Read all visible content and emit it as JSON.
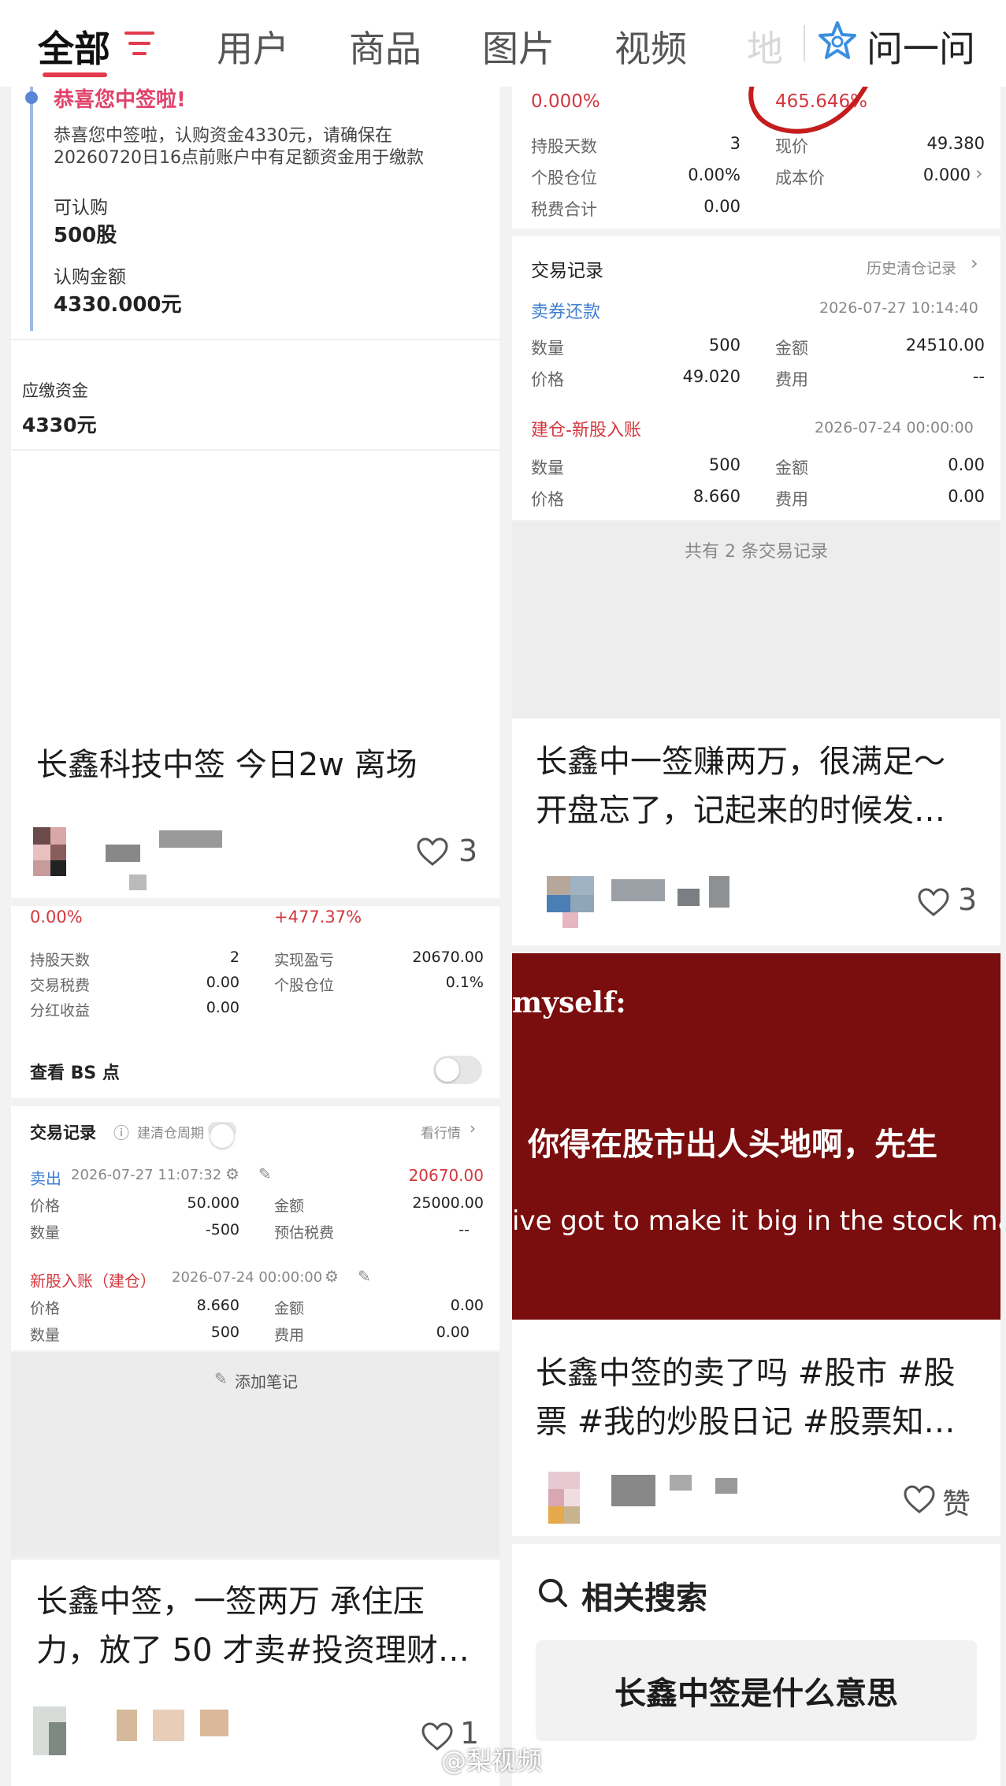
{
  "tabs": {
    "all": "全部",
    "user": "用户",
    "goods": "商品",
    "image": "图片",
    "video": "视频",
    "place": "地",
    "ask": "问一问"
  },
  "colors": {
    "accent": "#e23a4e",
    "profit_red": "#d4373f",
    "link_blue": "#3f7fd0",
    "hero_bg": "#7a0d0d"
  },
  "left_post1": {
    "notice_title": "恭喜您中签啦!",
    "notice_body1": "恭喜您中签啦，认购资金4330元，请确保在",
    "notice_body2": "20260720日16点前账户中有足额资金用于缴款",
    "buy_label": "可认购",
    "buy_value": "500股",
    "amount_label": "认购金额",
    "amount_value": "4330.000元",
    "due_label": "应缴资金",
    "due_value": "4330元",
    "title": "长鑫科技中签 今日2w 离场",
    "likes": "3"
  },
  "left_post2": {
    "pct_left": "0.00%",
    "pct_right": "+477.37%",
    "rows": [
      {
        "l1": "持股天数",
        "v1": "2",
        "l2": "实现盈亏",
        "v2": "20670.00"
      },
      {
        "l1": "交易税费",
        "v1": "0.00",
        "l2": "个股仓位",
        "v2": "0.1%"
      },
      {
        "l1": "分红收益",
        "v1": "0.00",
        "l2": "",
        "v2": ""
      }
    ],
    "bs_label": "查看 BS 点",
    "records_label": "交易记录",
    "cycle_label": "建清仓周期",
    "view_market": "看行情",
    "sell_tag": "卖出",
    "sell_time": "2026-07-27 11:07:32",
    "sell_amount": "20670.00",
    "sell_rows": [
      {
        "l1": "价格",
        "v1": "50.000",
        "l2": "金额",
        "v2": "25000.00"
      },
      {
        "l1": "数量",
        "v1": "-500",
        "l2": "预估税费",
        "v2": "--"
      }
    ],
    "buy_tag": "新股入账（建仓）",
    "buy_time": "2026-07-24 00:00:00",
    "buy_rows": [
      {
        "l1": "价格",
        "v1": "8.660",
        "l2": "金额",
        "v2": "0.00"
      },
      {
        "l1": "数量",
        "v1": "500",
        "l2": "费用",
        "v2": "0.00"
      }
    ],
    "add_note": "添加笔记"
  },
  "left_post3": {
    "title_line1": "长鑫中签，一签两万 承住压",
    "title_line2": "力，放了 50 才卖#投资理财…",
    "likes": "1"
  },
  "right_post1": {
    "pct_left": "0.000%",
    "pct_right": "465.646%",
    "rows": [
      {
        "l1": "持股天数",
        "v1": "3",
        "l2": "现价",
        "v2": "49.380"
      },
      {
        "l1": "个股仓位",
        "v1": "0.00%",
        "l2": "成本价",
        "v2": "0.000"
      },
      {
        "l1": "税费合计",
        "v1": "0.00",
        "l2": "",
        "v2": ""
      }
    ],
    "records_label": "交易记录",
    "history_label": "历史清仓记录",
    "r1_tag": "卖券还款",
    "r1_time": "2026-07-27 10:14:40",
    "r1_rows": [
      {
        "l1": "数量",
        "v1": "500",
        "l2": "金额",
        "v2": "24510.00"
      },
      {
        "l1": "价格",
        "v1": "49.020",
        "l2": "费用",
        "v2": "--"
      }
    ],
    "r2_tag": "建仓-新股入账",
    "r2_time": "2026-07-24 00:00:00",
    "r2_rows": [
      {
        "l1": "数量",
        "v1": "500",
        "l2": "金额",
        "v2": "0.00"
      },
      {
        "l1": "价格",
        "v1": "8.660",
        "l2": "费用",
        "v2": "0.00"
      }
    ],
    "total": "共有 2 条交易记录",
    "title_line1": "长鑫中一签赚两万，很满足～",
    "title_line2": "开盘忘了，记起来的时候发…",
    "likes": "3"
  },
  "right_post2": {
    "hero_top": "myself:",
    "hero_cn": "你得在股市出人头地啊，先生",
    "hero_en": "ive got to make it big in the stock marke",
    "title_line1": "长鑫中签的卖了吗 #股市 #股",
    "title_line2": "票 #我的炒股日记 #股票知…",
    "like_label": "赞"
  },
  "related": {
    "heading": "相关搜索",
    "suggestion": "长鑫中签是什么意思"
  },
  "watermark": "@梨视频"
}
